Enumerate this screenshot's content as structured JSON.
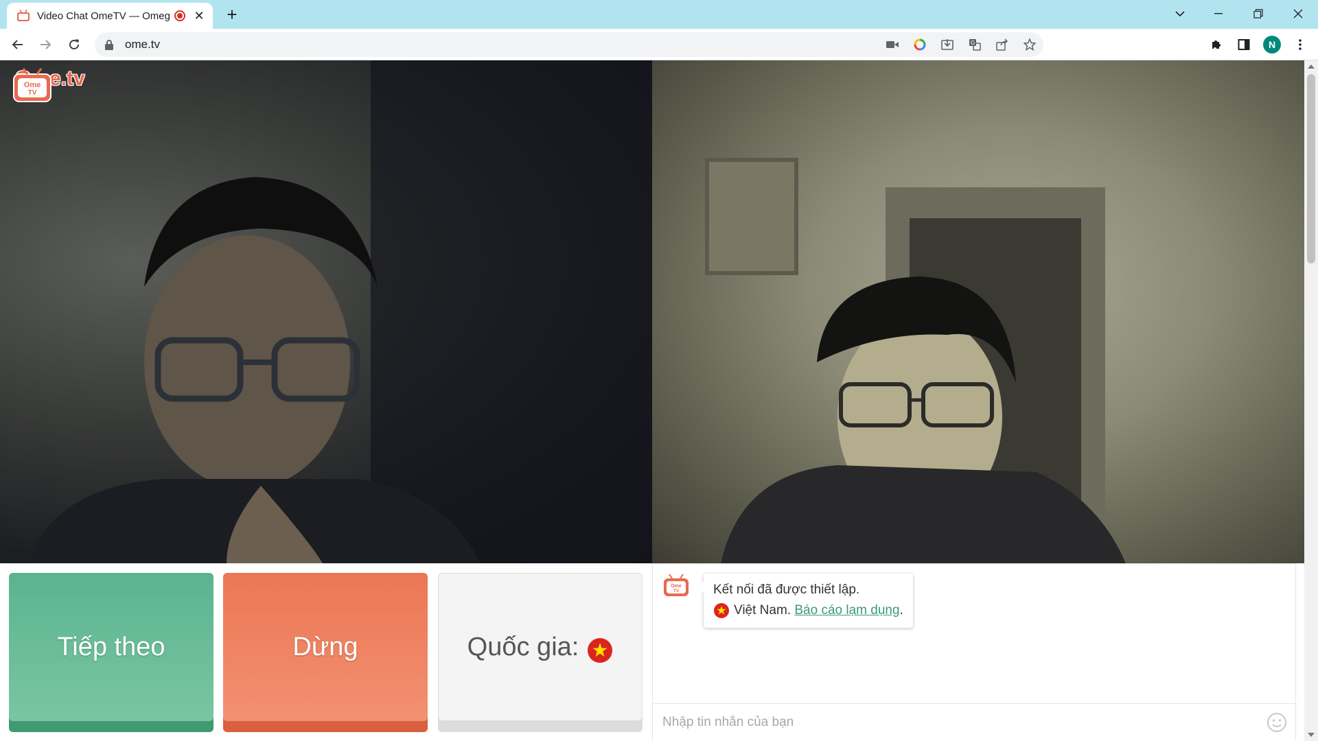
{
  "browser": {
    "tab_title": "Video Chat OmeTV — Omegle",
    "new_tab_label": "+",
    "url": "ome.tv",
    "profile_initial": "N"
  },
  "site": {
    "logo_icon_text": "Ome TV",
    "logo_text": "Ome.tv"
  },
  "controls": {
    "next_label": "Tiếp theo",
    "stop_label": "Dừng",
    "country_label": "Quốc gia:"
  },
  "chat": {
    "message_line1": "Kết nối đã được thiết lập.",
    "country_name": "Việt Nam.",
    "report_link": "Báo cáo lạm dụng",
    "report_suffix": ".",
    "input_placeholder": "Nhập tin nhắn của bạn"
  },
  "colors": {
    "next_button": "#5ab48e",
    "stop_button": "#ec7655",
    "link": "#3a9a72",
    "tab_strip": "#b2e4f0",
    "flag_red": "#da251d",
    "flag_star": "#ffde00"
  },
  "icons": {
    "back": "arrow-left-icon",
    "forward": "arrow-right-icon",
    "reload": "reload-icon",
    "lock": "lock-icon",
    "camera": "camera-icon",
    "google": "google-icon",
    "install": "install-icon",
    "translate": "translate-icon",
    "share": "share-icon",
    "bookmark": "star-icon",
    "extensions": "puzzle-icon",
    "side_panel": "side-panel-icon",
    "menu": "kebab-menu-icon",
    "emoji": "smiley-icon"
  }
}
